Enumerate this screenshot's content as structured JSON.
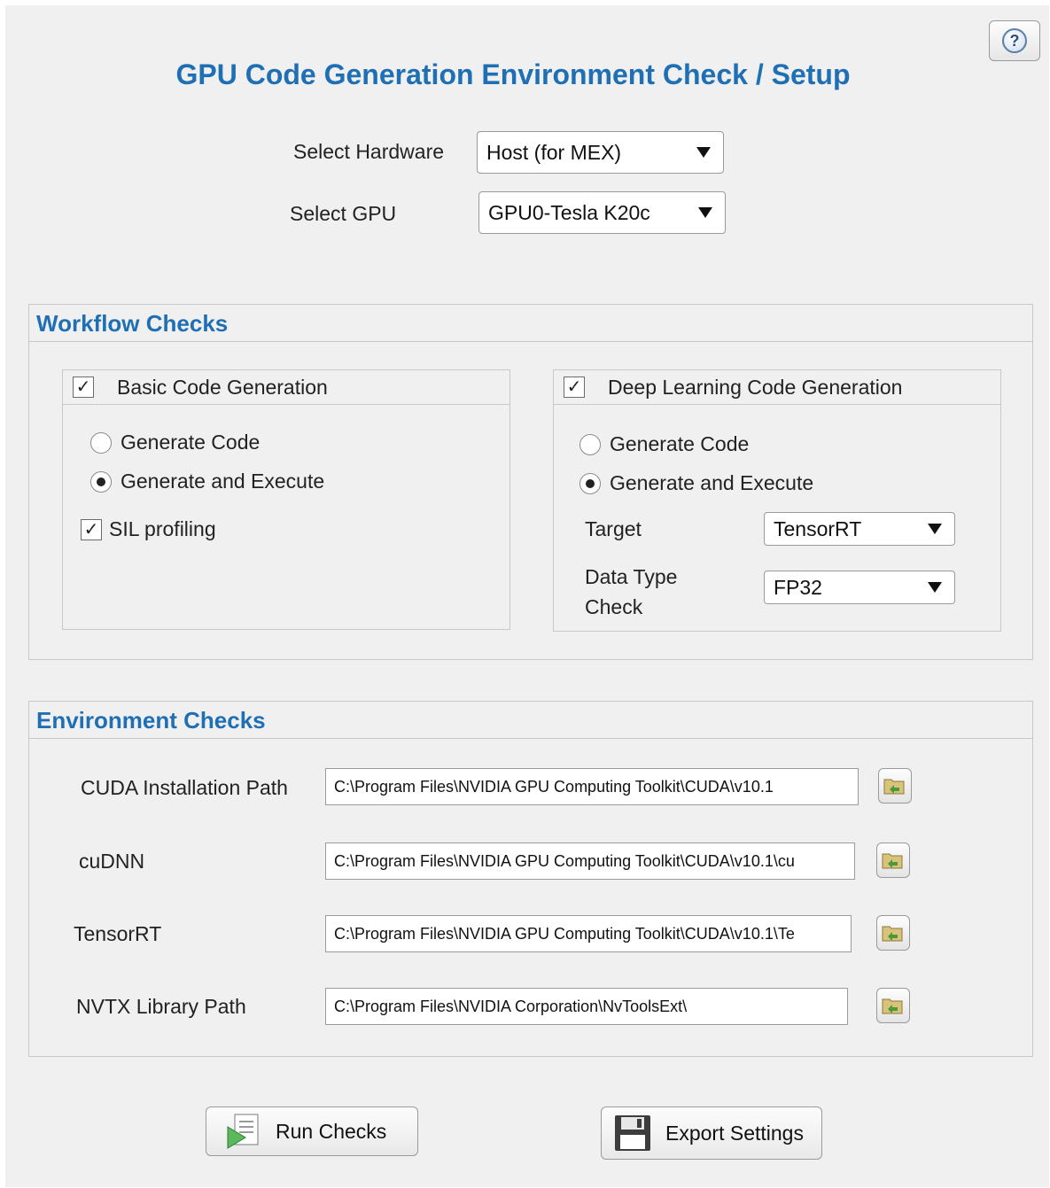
{
  "app": {
    "title": "GPU Code Generation Environment Check / Setup",
    "help_icon": "?"
  },
  "hardware": {
    "select_hardware_label": "Select Hardware",
    "hardware_value": "Host (for MEX)",
    "select_gpu_label": "Select GPU",
    "gpu_value": "GPU0-Tesla K20c"
  },
  "workflow": {
    "title": "Workflow Checks",
    "basic": {
      "checked": true,
      "label": "Basic Code Generation",
      "radio_generate_code": "Generate Code",
      "radio_generate_execute": "Generate and Execute",
      "selected": "Generate and Execute",
      "sil_checked": true,
      "sil_label": "SIL profiling"
    },
    "deep": {
      "checked": true,
      "label": "Deep Learning Code Generation",
      "radio_generate_code": "Generate Code",
      "radio_generate_execute": "Generate and Execute",
      "selected": "Generate and Execute",
      "target_label": "Target",
      "target_value": "TensorRT",
      "datatype_label_1": "Data Type",
      "datatype_label_2": "Check",
      "datatype_value": "FP32"
    }
  },
  "environment": {
    "title": "Environment Checks",
    "rows": [
      {
        "label": "CUDA Installation Path",
        "value": "C:\\Program Files\\NVIDIA GPU Computing Toolkit\\CUDA\\v10.1"
      },
      {
        "label": "cuDNN",
        "value": "C:\\Program Files\\NVIDIA GPU Computing Toolkit\\CUDA\\v10.1\\cu"
      },
      {
        "label": "TensorRT",
        "value": "C:\\Program Files\\NVIDIA GPU Computing Toolkit\\CUDA\\v10.1\\Te"
      },
      {
        "label": "NVTX Library Path",
        "value": "C:\\Program Files\\NVIDIA Corporation\\NvToolsExt\\"
      }
    ]
  },
  "actions": {
    "run_checks": "Run Checks",
    "export_settings": "Export Settings"
  },
  "colors": {
    "accent": "#1f6fb5",
    "background": "#f0f0f0"
  }
}
